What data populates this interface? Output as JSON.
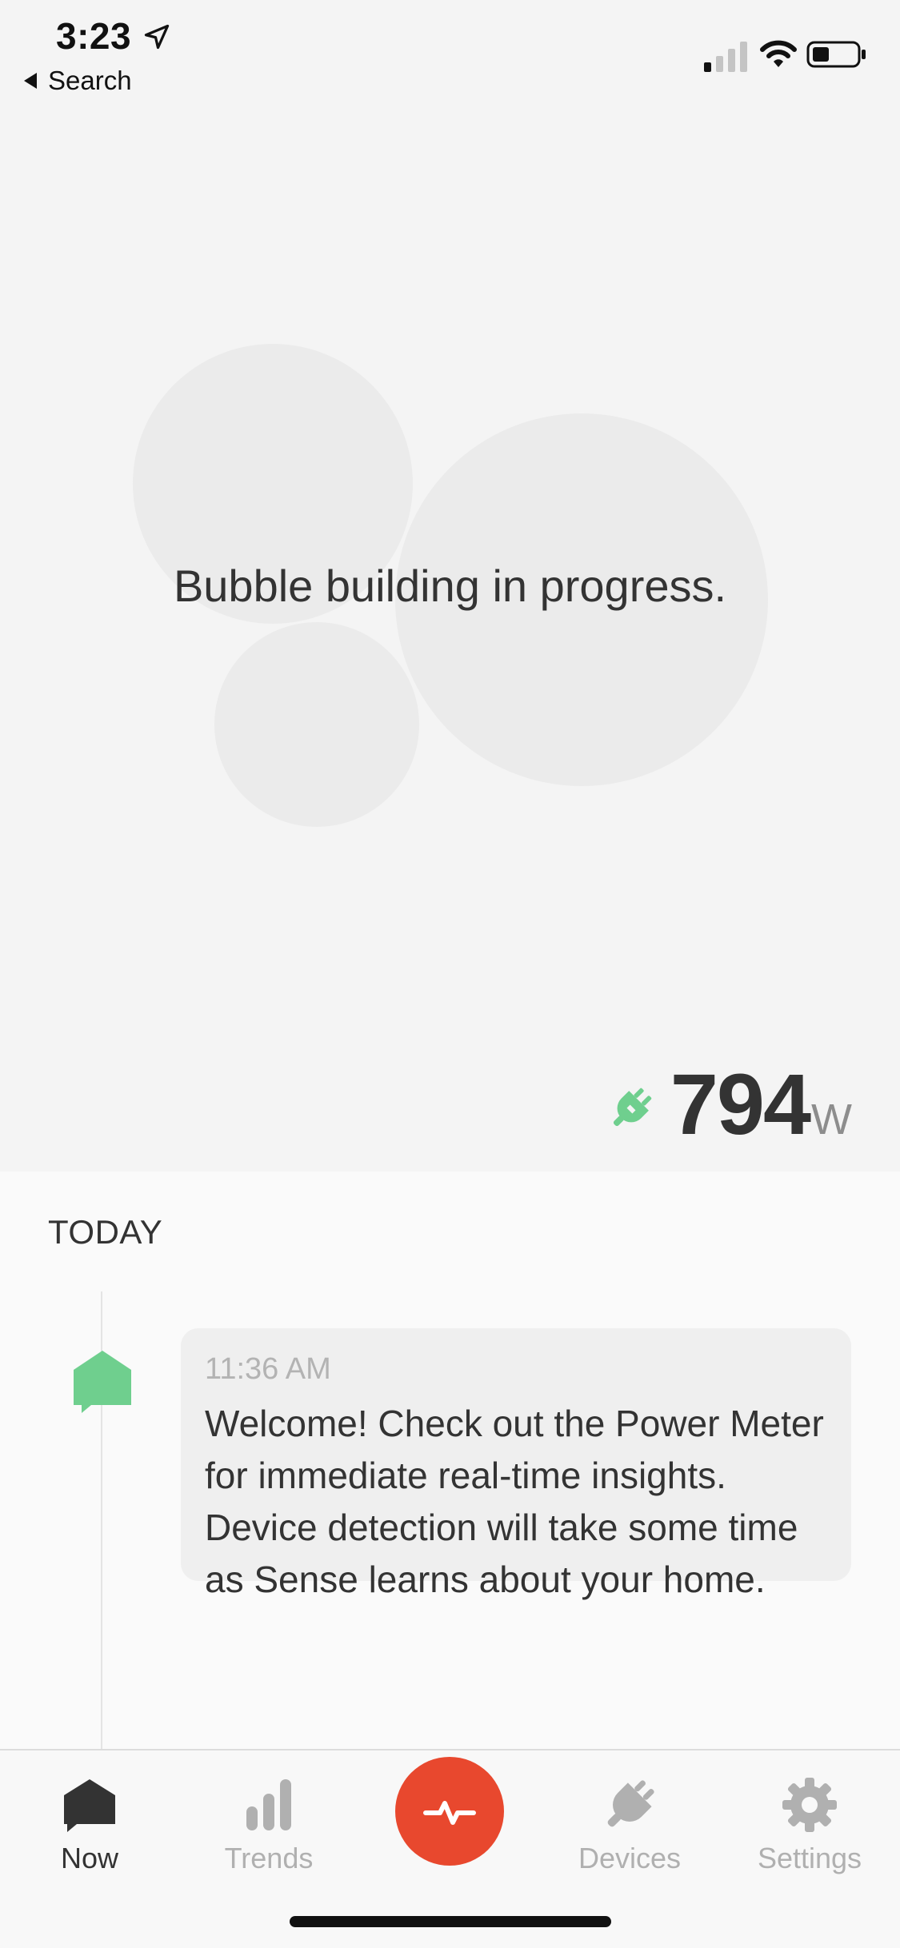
{
  "status_bar": {
    "time": "3:23",
    "back_label": "Search",
    "icons": [
      "location-arrow-icon",
      "cellular-signal-icon",
      "wifi-icon",
      "battery-icon"
    ]
  },
  "now": {
    "bubble_message": "Bubble building in progress.",
    "power": {
      "value": "794",
      "unit": "W",
      "icon": "plug-icon"
    }
  },
  "feed": {
    "heading": "TODAY",
    "items": [
      {
        "time": "11:36 AM",
        "text": "Welcome! Check out the Power Meter for immediate real-time insights. Device detection will take some time as Sense learns about your home.",
        "icon": "home-message-icon"
      }
    ]
  },
  "tab_bar": {
    "tabs": [
      {
        "label": "Now",
        "icon": "now-icon",
        "active": true
      },
      {
        "label": "Trends",
        "icon": "trends-icon",
        "active": false
      },
      {
        "label": "Devices",
        "icon": "plug-icon",
        "active": false
      },
      {
        "label": "Settings",
        "icon": "gear-icon",
        "active": false
      }
    ],
    "center_button_icon": "power-meter-pulse-icon"
  },
  "colors": {
    "accent_red": "#e8482e",
    "accent_green": "#6fcf8e",
    "active_tab": "#333333",
    "inactive_tab": "#b0b0b0",
    "background": "#f4f4f4"
  }
}
